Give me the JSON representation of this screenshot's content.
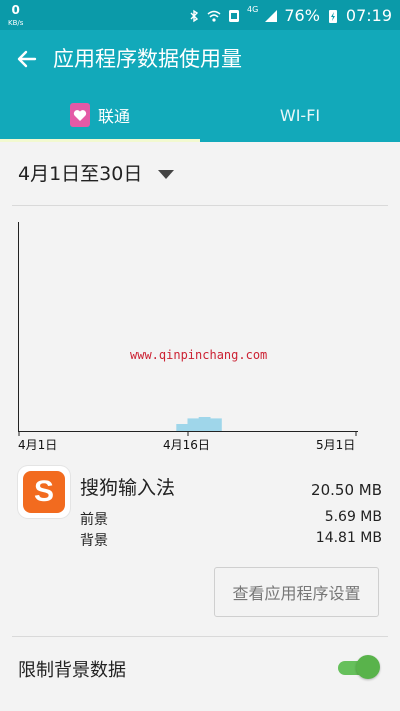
{
  "status_bar": {
    "net_speed": "0",
    "net_speed_unit": "KB/s",
    "network_type": "4G",
    "battery": "76%",
    "time": "07:19",
    "icons": [
      "bluetooth-icon",
      "wifi-icon",
      "nfc-icon",
      "signal-icon",
      "battery-charging-icon"
    ]
  },
  "header": {
    "title": "应用程序数据使用量",
    "back_icon": "arrow-left-icon"
  },
  "tabs": [
    {
      "label": "联通",
      "icon": "sim-heart-icon",
      "selected": true
    },
    {
      "label": "WI-FI",
      "selected": false
    }
  ],
  "period": {
    "label": "4月1日至30日",
    "dropdown_icon": "triangle-down-icon"
  },
  "chart_data": {
    "type": "area",
    "x": [
      "4月1日",
      "4月16日",
      "5月1日"
    ],
    "note_watermark": "www.qinpinchang.com",
    "series": [
      {
        "values_pattern": [
          0,
          0,
          0,
          0,
          0,
          0,
          0,
          0,
          0,
          0,
          0,
          0,
          0,
          0,
          0.5,
          0.9,
          1,
          0.9,
          0,
          0,
          0,
          0,
          0,
          0,
          0,
          0,
          0,
          0,
          0,
          0
        ]
      }
    ]
  },
  "watermark": "www.qinpinchang.com",
  "app": {
    "name": "搜狗输入法",
    "total": "20.50 MB",
    "foreground_label": "前景",
    "foreground_value": "5.69 MB",
    "background_label": "背景",
    "background_value": "14.81 MB",
    "settings_button": "查看应用程序设置",
    "icon_letter": "S"
  },
  "restrict": {
    "label": "限制背景数据",
    "toggle_on": true
  },
  "colors": {
    "statusbar": "#0b9aa9",
    "appbar": "#12a9ba",
    "tab_indicator": "#f2f9d0",
    "chart_fill": "#9fd6ea",
    "toggle": "#59b34b",
    "app_icon": "#f26b1f"
  }
}
